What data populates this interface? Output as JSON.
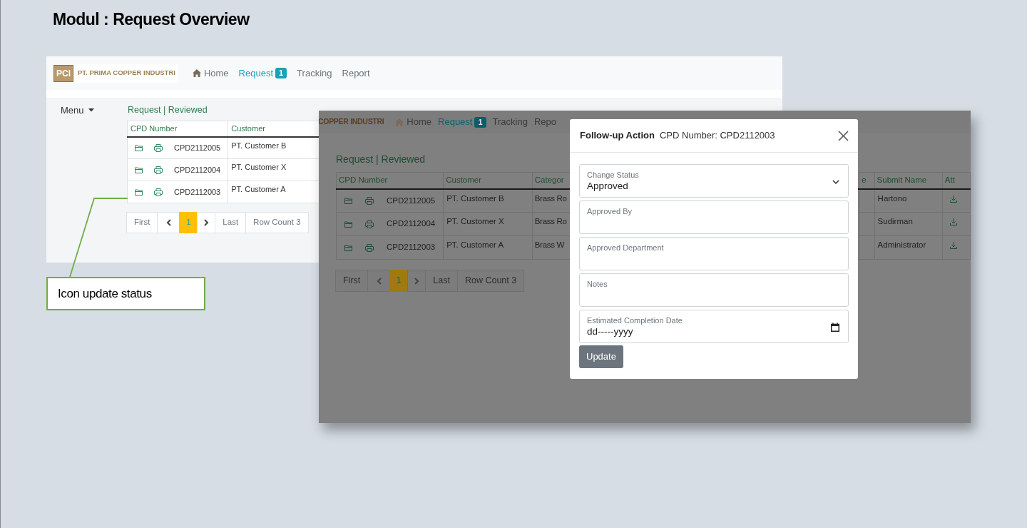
{
  "title": "Modul : Request Overview",
  "main_screen": {
    "logo_mark": "PCI",
    "brand": "PT. PRIMA COPPER INDUSTRI",
    "nav": [
      {
        "label": "Home",
        "kind": "home",
        "selected": false
      },
      {
        "label": "Request",
        "badge": "1",
        "selected": true
      },
      {
        "label": "Tracking",
        "selected": false
      },
      {
        "label": "Report",
        "selected": false
      }
    ],
    "menu": "Menu",
    "breadcrumb": "Request | Reviewed",
    "table": {
      "columns": [
        "CPD Number",
        "Customer"
      ],
      "rows": [
        {
          "cpd": "CPD2112005",
          "customer": "PT. Customer B"
        },
        {
          "cpd": "CPD2112004",
          "customer": "PT. Customer X"
        },
        {
          "cpd": "CPD2112003",
          "customer": "PT. Customer A"
        }
      ]
    },
    "pagination": {
      "first": "First",
      "pages": [
        {
          "label": "1",
          "selected": true
        }
      ],
      "last": "Last",
      "count": "Row Count 3"
    }
  },
  "dialog_screen": {
    "brand": "COPPER INDUSTRI",
    "nav": [
      {
        "label": "Home",
        "kind": "home",
        "selected": false
      },
      {
        "label": "Request",
        "badge": "1",
        "selected": true
      },
      {
        "label": "Tracking",
        "selected": false
      },
      {
        "label": "Repo",
        "selected": false
      }
    ],
    "breadcrumb": "Request | Reviewed",
    "table": {
      "columns": [
        "CPD Number",
        "Customer",
        "Categor",
        "e",
        "Submit Name",
        "Att"
      ],
      "rows": [
        {
          "cpd": "CPD2112005",
          "customer": "PT. Customer B",
          "category": "Brass Ro",
          "submit_name": "Hartono"
        },
        {
          "cpd": "CPD2112004",
          "customer": "PT. Customer X",
          "category": "Brass Ro",
          "submit_name": "Sudirman"
        },
        {
          "cpd": "CPD2112003",
          "customer": "PT. Customer A",
          "category": "Brass W",
          "submit_name": "Administrator"
        }
      ]
    },
    "pagination": {
      "first": "First",
      "pages": [
        {
          "label": "1",
          "selected": true
        }
      ],
      "last": "Last",
      "count": "Row Count 3"
    },
    "dialog": {
      "title": "Follow-up Action",
      "subtitle": "CPD Number: CPD2112003",
      "fields": [
        {
          "kind": "select",
          "label": "Change Status",
          "value": "Approved"
        },
        {
          "kind": "text",
          "label": "Approved By"
        },
        {
          "kind": "text",
          "label": "Approved Department"
        },
        {
          "kind": "text",
          "label": "Notes"
        },
        {
          "kind": "date",
          "label": "Estimated Completion Date",
          "value": "dd-----yyyy"
        }
      ],
      "button": "Update"
    }
  },
  "callout": {
    "text": "Icon update status"
  }
}
